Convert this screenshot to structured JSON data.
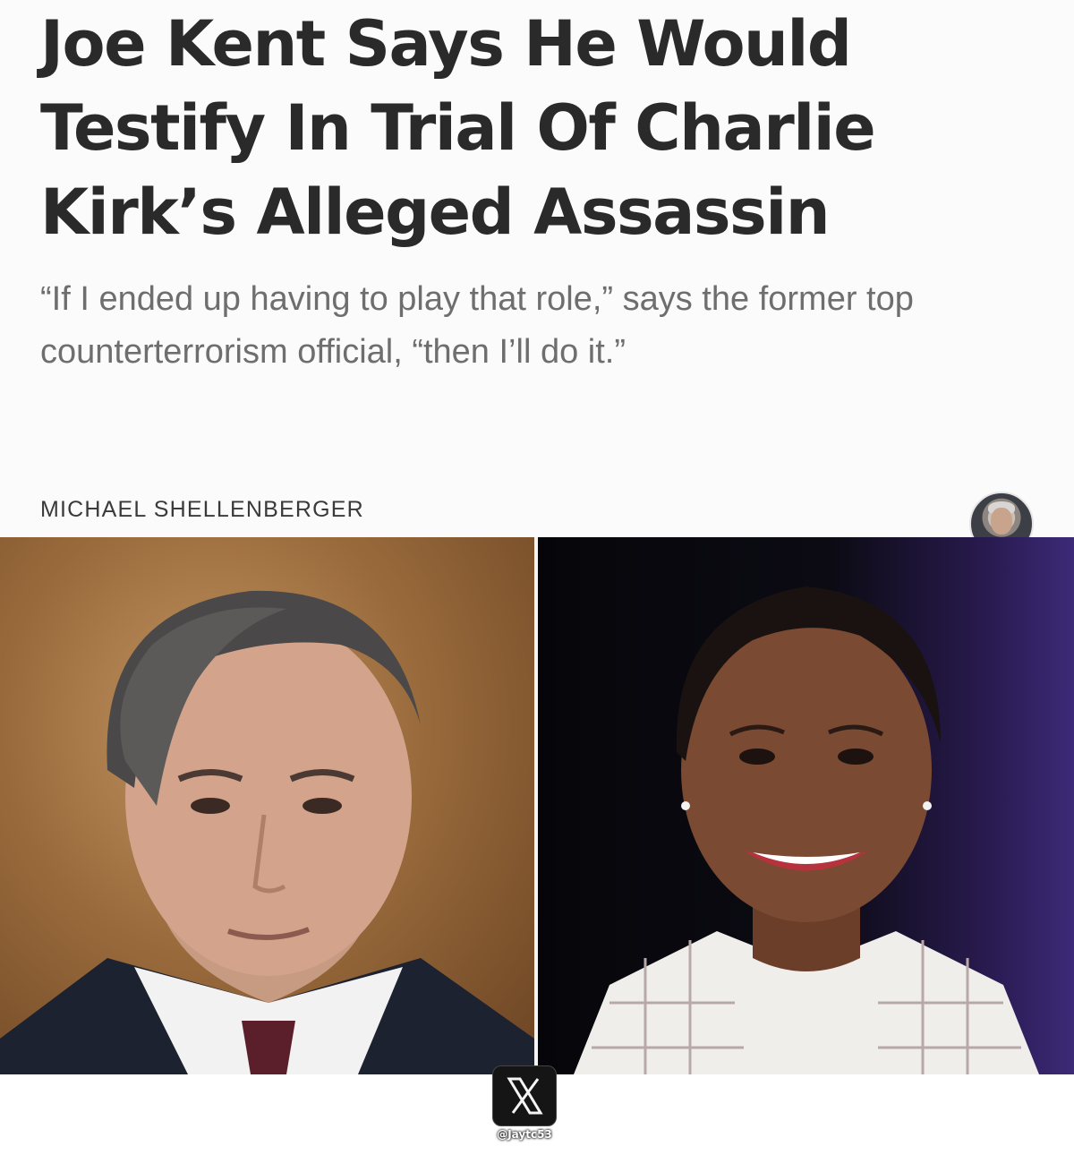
{
  "article": {
    "headline": "Joe Kent Says He Would Testify In Trial Of Charlie Kirk’s Alleged Assassin",
    "dek": "“If I ended up having to play that role,” says the former top counterterrorism official, “then I’ll do it.”",
    "byline": "MICHAEL SHELLENBERGER",
    "author_avatar_icon": "author-avatar"
  },
  "photos": {
    "left": {
      "description_icon": "man-portrait-photo"
    },
    "right": {
      "description_icon": "woman-portrait-photo"
    },
    "watermark": {
      "logo_icon": "x-logo-icon",
      "handle": "@Jaytc53"
    }
  },
  "colors": {
    "headline": "#2a2a2a",
    "dek": "#6e6e6e",
    "byline": "#3a3a3a",
    "background": "#fbfbfb"
  }
}
